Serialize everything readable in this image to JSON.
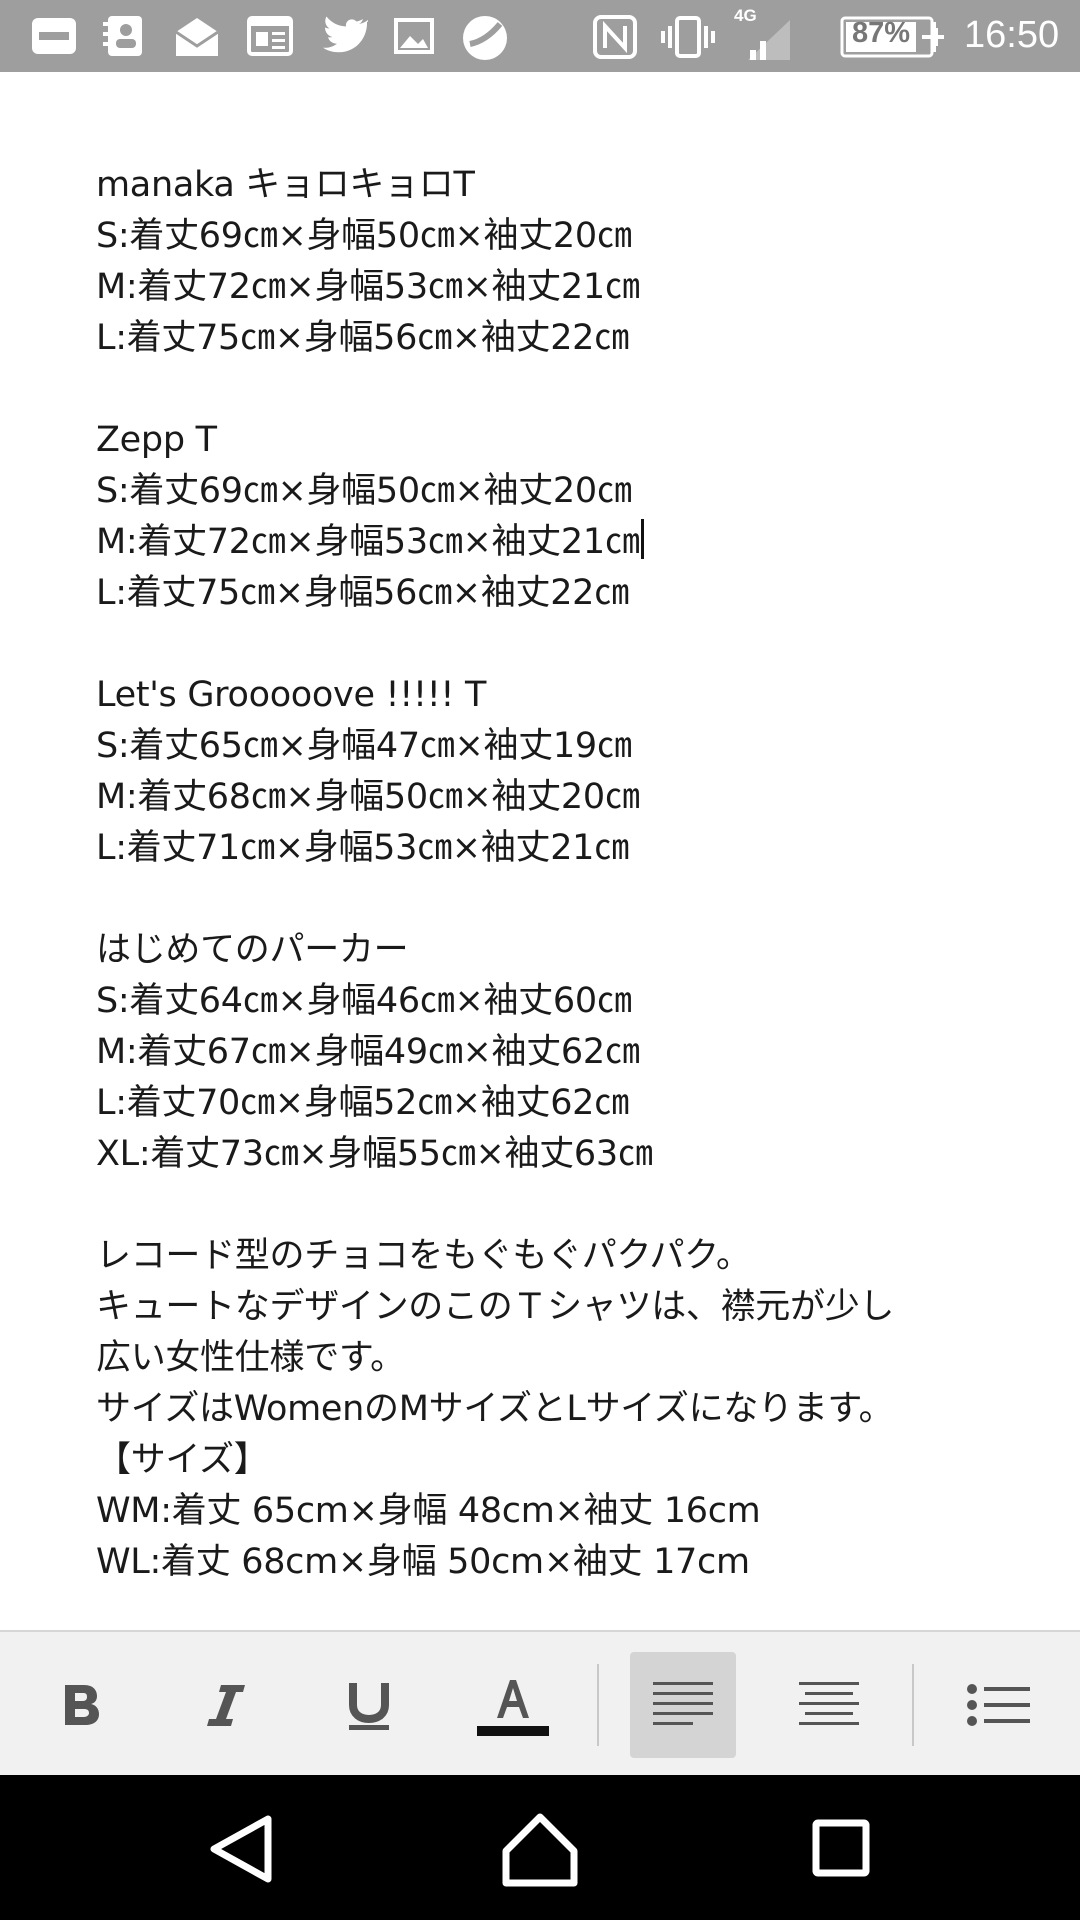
{
  "status_bar": {
    "battery_percent": "87%",
    "network": "4G",
    "time": "16:50",
    "icons": [
      "newspaper-app-icon",
      "contacts-icon",
      "mail-icon",
      "news-icon",
      "twitter-icon",
      "gallery-icon",
      "app-icon",
      "nfc-icon",
      "vibrate-icon",
      "signal-icon",
      "battery-icon"
    ]
  },
  "document": {
    "lines": [
      "manaka キョロキョロT",
      "S:着丈69㎝×身幅50㎝×袖丈20㎝",
      "M:着丈72㎝×身幅53㎝×袖丈21㎝",
      "L:着丈75㎝×身幅56㎝×袖丈22㎝",
      "",
      "Zepp T",
      "S:着丈69㎝×身幅50㎝×袖丈20㎝",
      "M:着丈72㎝×身幅53㎝×袖丈21㎝",
      "L:着丈75㎝×身幅56㎝×袖丈22㎝",
      "",
      "Let's Grooooove !!!!! T",
      "S:着丈65㎝×身幅47㎝×袖丈19㎝",
      "M:着丈68㎝×身幅50㎝×袖丈20㎝",
      "L:着丈71㎝×身幅53㎝×袖丈21㎝",
      "",
      "はじめてのパーカー",
      "S:着丈64㎝×身幅46㎝×袖丈60㎝",
      "M:着丈67㎝×身幅49㎝×袖丈62㎝",
      "L:着丈70㎝×身幅52㎝×袖丈62㎝",
      "XL:着丈73㎝×身幅55㎝×袖丈63㎝",
      "",
      "レコード型のチョコをもぐもぐパクパク。",
      "キュートなデザインのこのＴシャツは、襟元が少し",
      "広い女性仕様です。",
      "サイズはWomenのMサイズとLサイズになります。",
      "【サイズ】",
      "WM:着丈 65cm×身幅 48cm×袖丈 16cm",
      "WL:着丈 68cm×身幅 50cm×袖丈 17cm"
    ]
  },
  "toolbar": {
    "buttons": [
      "bold",
      "italic",
      "underline",
      "text-color",
      "align-left",
      "align-center",
      "bulleted-list"
    ],
    "active": "align-left"
  },
  "navbar": {
    "buttons": [
      "back",
      "home",
      "recents"
    ]
  },
  "colors": {
    "status_bar": "#9e9e9e",
    "toolbar_bg": "#f1f1f1",
    "toolbar_active": "#d4d4d4",
    "icon": "#555555",
    "nav_bg": "#000000"
  }
}
